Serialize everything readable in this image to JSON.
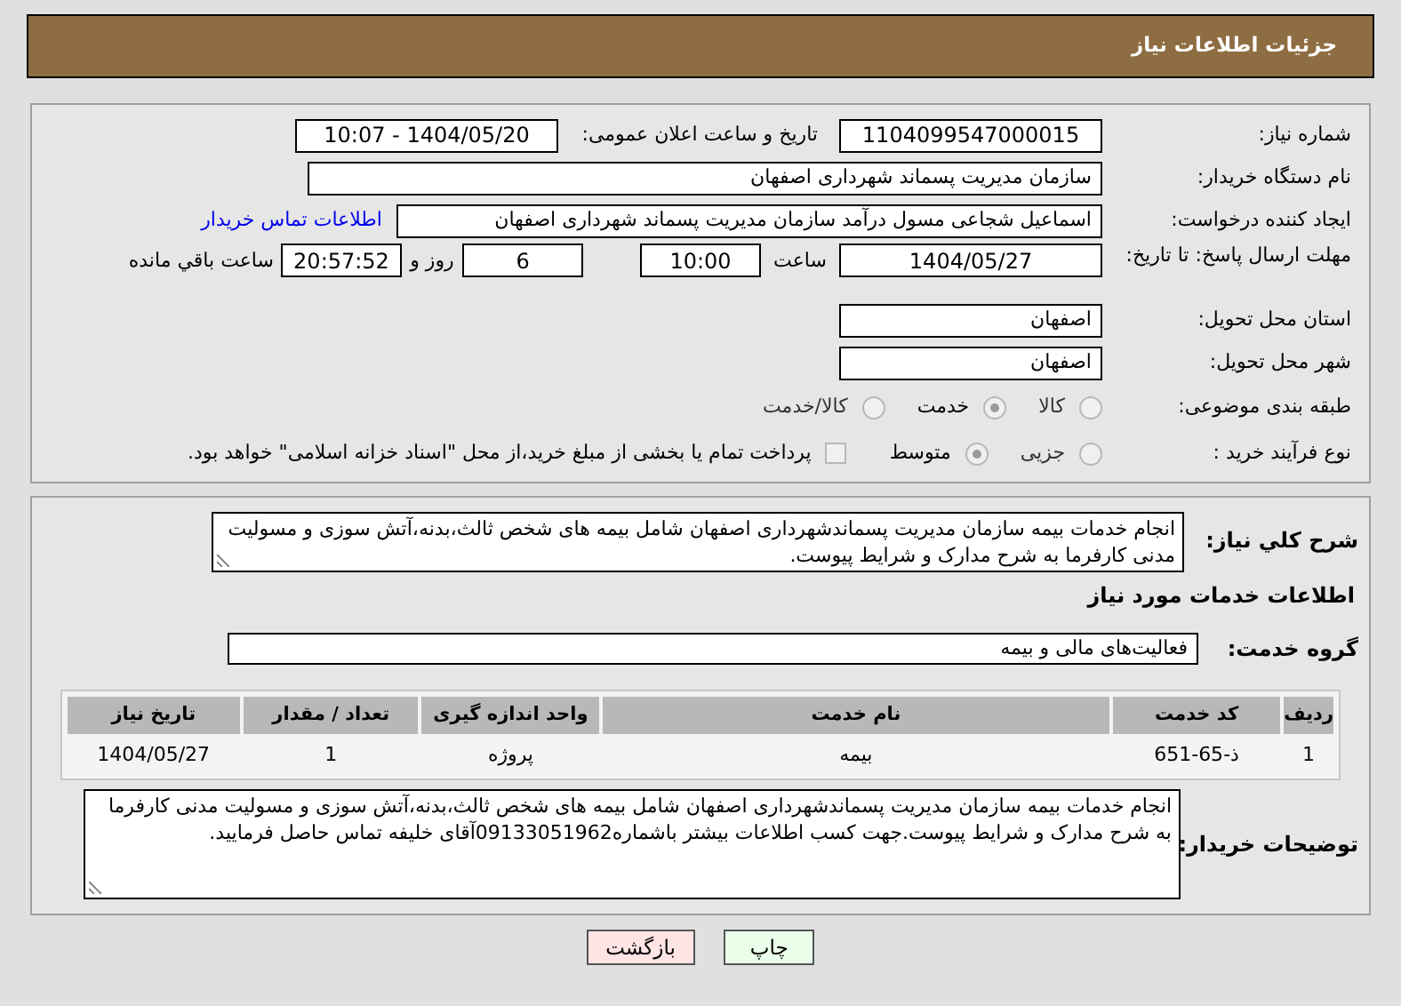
{
  "header": {
    "title": "جزئیات اطلاعات نیاز"
  },
  "need_number": {
    "label": "شماره نیاز:",
    "value": "1104099547000015"
  },
  "announce": {
    "label": "تاریخ و ساعت اعلان عمومی:",
    "value": "1404/05/20 - 10:07"
  },
  "buyer_org": {
    "label": "نام دستگاه خریدار:",
    "value": "سازمان مدیریت پسماند شهرداری اصفهان"
  },
  "requester": {
    "label": "ایجاد کننده درخواست:",
    "value": "اسماعیل شجاعی مسول درآمد سازمان مدیریت پسماند شهرداری اصفهان",
    "link": "اطلاعات تماس خریدار"
  },
  "deadline": {
    "label": "مهلت ارسال پاسخ: تا تاریخ:",
    "date": "1404/05/27",
    "time_label": "ساعت",
    "time": "10:00",
    "days": "6",
    "days_label": "روز و",
    "remaining": "20:57:52",
    "remaining_label": "ساعت باقي مانده"
  },
  "province": {
    "label": "استان محل تحویل:",
    "value": "اصفهان"
  },
  "city": {
    "label": "شهر محل تحویل:",
    "value": "اصفهان"
  },
  "category": {
    "label": "طبقه بندی موضوعی:",
    "options": [
      {
        "label": "کالا",
        "selected": false
      },
      {
        "label": "خدمت",
        "selected": true
      },
      {
        "label": "کالا/خدمت",
        "selected": false
      }
    ]
  },
  "process": {
    "label": "نوع فرآیند خرید :",
    "options": [
      {
        "label": "جزیی",
        "selected": false
      },
      {
        "label": "متوسط",
        "selected": true
      }
    ],
    "payment": {
      "label": "پرداخت تمام یا بخشی از مبلغ خرید،از محل \"اسناد خزانه اسلامی\" خواهد بود.",
      "checked": false
    }
  },
  "description": {
    "label": "شرح کلي نياز:",
    "value": "انجام خدمات بیمه سازمان مدیریت پسماندشهرداری اصفهان شامل بیمه های شخص ثالث،بدنه،آتش سوزی و مسولیت مدنی کارفرما به شرح مدارک و شرایط پیوست."
  },
  "services_title": "اطلاعات خدمات مورد نياز",
  "service_group": {
    "label": "گروه خدمت:",
    "value": "فعالیت‌های مالی و بیمه"
  },
  "table": {
    "columns": [
      "ردیف",
      "کد خدمت",
      "نام خدمت",
      "واحد اندازه گیری",
      "تعداد / مقدار",
      "تاریخ نیاز"
    ],
    "rows": [
      [
        "1",
        "ذ-65-651",
        "بیمه",
        "پروژه",
        "1",
        "1404/05/27"
      ]
    ]
  },
  "buyer_notes": {
    "label": "توضیحات خریدار:",
    "value": "انجام خدمات بیمه سازمان مدیریت پسماندشهرداری اصفهان شامل بیمه های شخص ثالث،بدنه،آتش سوزی و مسولیت مدنی کارفرما به شرح مدارک و شرایط پیوست.جهت کسب اطلاعات بیشتر باشماره09133051962آقای خلیفه تماس حاصل فرمایید."
  },
  "buttons": [
    {
      "label": "چاپ",
      "kind": "print"
    },
    {
      "label": "بازگشت",
      "kind": "back"
    }
  ]
}
